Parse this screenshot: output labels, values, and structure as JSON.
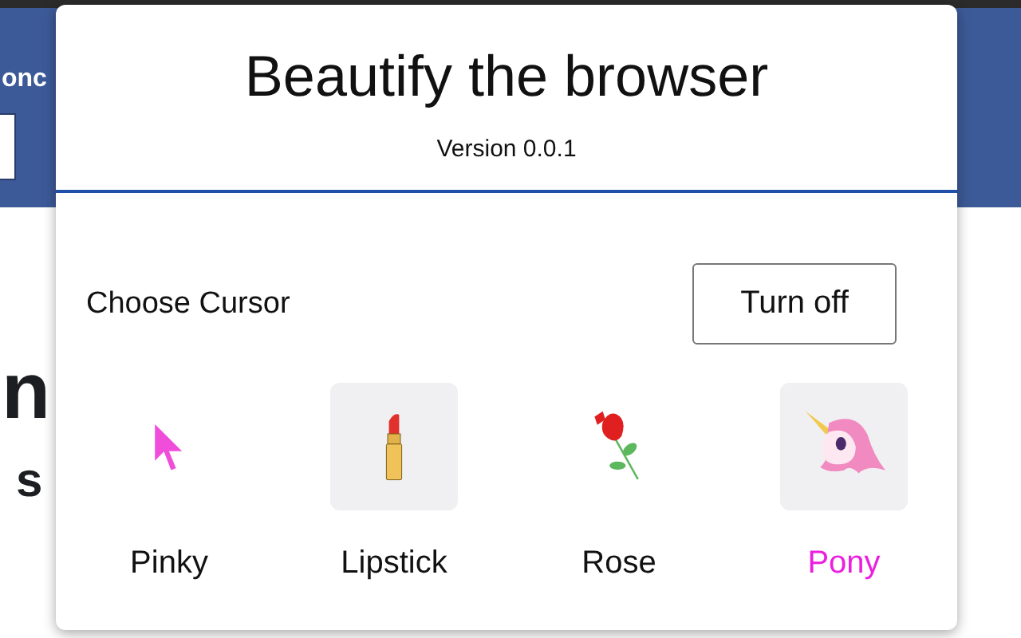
{
  "background_page": {
    "header_text": "onc",
    "heading": "n",
    "subheading": "s"
  },
  "popup": {
    "title": "Beautify the browser",
    "version": "Version 0.0.1",
    "section_label": "Choose Cursor",
    "toggle_button": "Turn off",
    "cursors": [
      {
        "kind": "arrow",
        "label": "Pinky",
        "selected": false,
        "highlighted": false
      },
      {
        "kind": "lipstick",
        "label": "Lipstick",
        "selected": false,
        "highlighted": true
      },
      {
        "kind": "rose",
        "label": "Rose",
        "selected": false,
        "highlighted": false
      },
      {
        "kind": "unicorn",
        "label": "Pony",
        "selected": true,
        "highlighted": true
      }
    ]
  }
}
